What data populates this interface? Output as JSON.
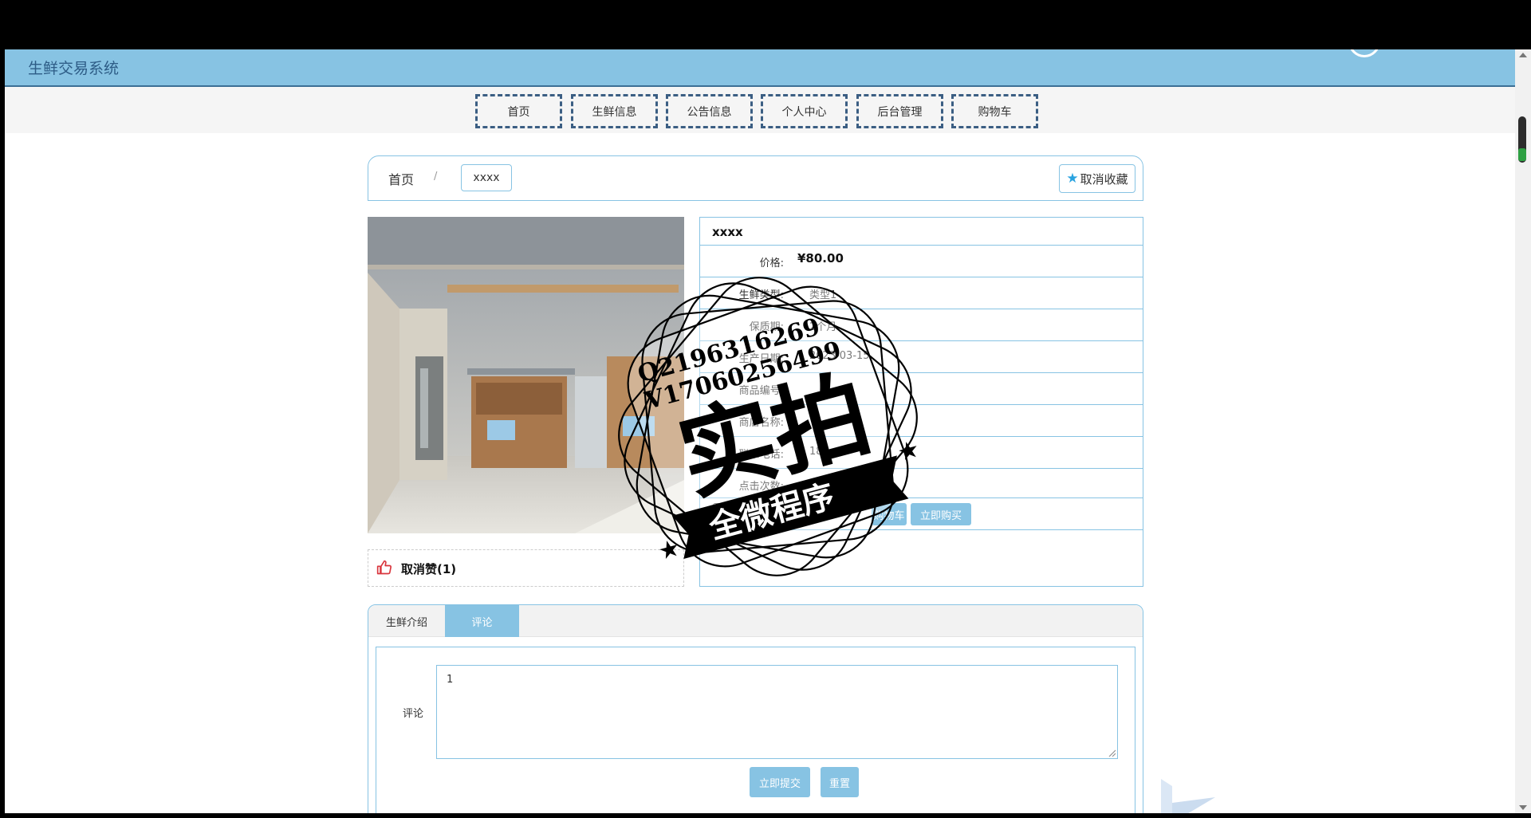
{
  "header": {
    "title": "生鲜交易系统"
  },
  "nav": {
    "items": [
      {
        "label": "首页"
      },
      {
        "label": "生鲜信息"
      },
      {
        "label": "公告信息"
      },
      {
        "label": "个人中心"
      },
      {
        "label": "后台管理"
      },
      {
        "label": "购物车"
      }
    ]
  },
  "breadcrumb": {
    "home": "首页",
    "separator": "/",
    "current": "xxxx"
  },
  "favorite": {
    "label": "取消收藏",
    "icon": "star-icon"
  },
  "like": {
    "label": "取消赞(1)",
    "icon": "thumbs-up-icon"
  },
  "product": {
    "title": "xxxx",
    "fields": [
      {
        "label": "价格:",
        "value": "¥80.00"
      },
      {
        "label": "生鲜类型:",
        "value": "类型1"
      },
      {
        "label": "保质期:",
        "value": "2个月"
      },
      {
        "label": "生产日期:",
        "value": "2023-03-15"
      },
      {
        "label": "商品编号:",
        "value": ""
      },
      {
        "label": "商店名称:",
        "value": ""
      },
      {
        "label": "联系电话:",
        "value": "181"
      },
      {
        "label": "点击次数:",
        "value": "4"
      }
    ],
    "add_to_cart_label": "购物车",
    "buy_label": "立即购买"
  },
  "tabs": [
    {
      "label": "生鲜介绍"
    },
    {
      "label": "评论"
    }
  ],
  "comment_form": {
    "label": "评论",
    "value": "1",
    "submit_label": "立即提交",
    "reset_label": "重置"
  },
  "watermark": {
    "line1": "Q2196316269",
    "line2": "V17060256499",
    "big": "实拍",
    "banner": "全微程序"
  },
  "colors": {
    "accent": "#87c3e3",
    "header_text": "#2d5c86",
    "nav_border": "#3b5e83",
    "star": "#29a3e0",
    "thumb": "#d9363e"
  }
}
